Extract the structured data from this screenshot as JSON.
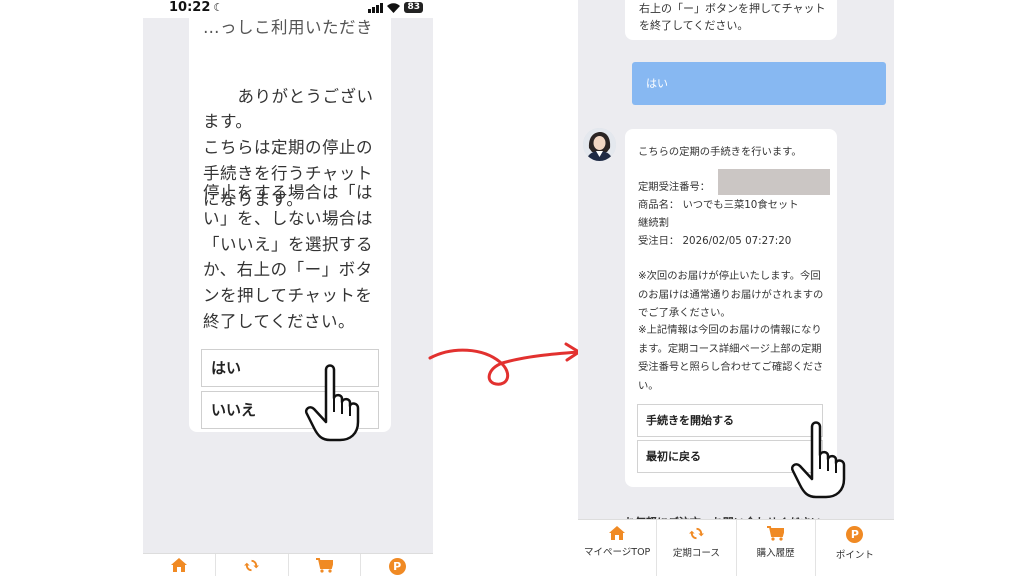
{
  "left_phone": {
    "status_bar": {
      "time": "10:22",
      "battery": "83"
    },
    "chat": {
      "cut_line": "…っしこ利用いただき",
      "paragraph1": "ありがとうございます。\nこちらは定期の停止の手続きを行うチャットになります。",
      "paragraph2": "停止をする場合は「はい」を、しない場合は「いいえ」を選択するか、右上の「ー」ボタンを押してチャットを終了してください。",
      "options": [
        "はい",
        "いいえ"
      ]
    }
  },
  "right_phone": {
    "top_bubble_text": "右上の「ー」ボタンを押してチャットを終了してください。",
    "user_message": "はい",
    "bot": {
      "intro": "こちらの定期の手続きを行います。",
      "order_label": "定期受注番号：",
      "product": "商品名： いつでも三菜10食セット",
      "product_line2": "継続割",
      "order_date": "受注日： 2026/02/05 07:27:20",
      "note1": "※次回のお届けが停止いたします。今回のお届けは通常通りお届けがされますのでご了承ください。",
      "note2": "※上記情報は今回のお届けの情報になります。定期コース詳細ページ上部の定期受注番号と照らし合わせてご確認ください。",
      "buttons": [
        "手続きを開始する",
        "最初に戻る"
      ]
    },
    "footer_text": "お気軽にご注文・お問い合わせください",
    "nav": [
      "マイページTOP",
      "定期コース",
      "購入履歴",
      "ポイント"
    ]
  },
  "accent_color": "#f08a24",
  "user_bubble_color": "#87b8f2"
}
